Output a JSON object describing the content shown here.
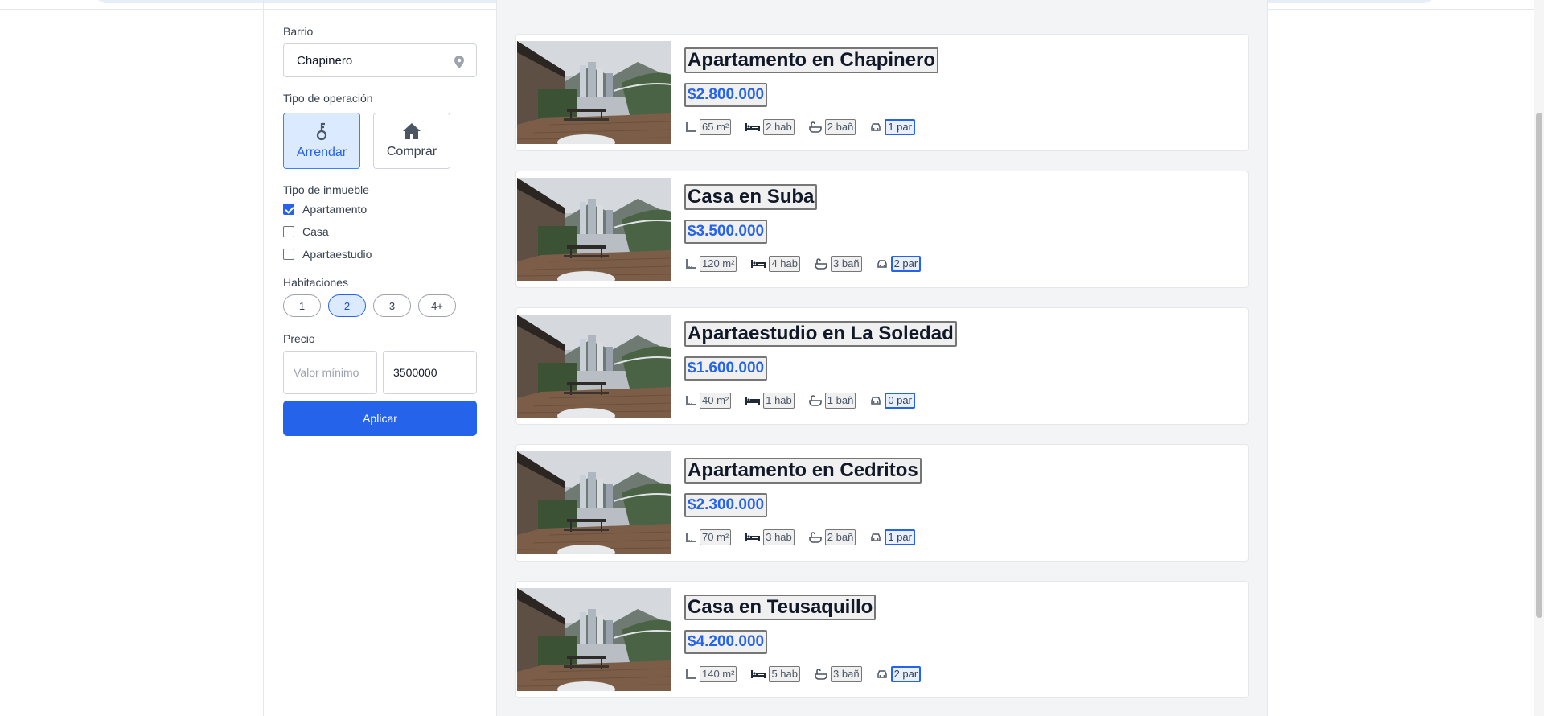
{
  "filters": {
    "barrio_label": "Barrio",
    "barrio_value": "Chapinero",
    "operation_label": "Tipo de operación",
    "operations": [
      {
        "label": "Arrendar",
        "icon": "key-icon",
        "active": true
      },
      {
        "label": "Comprar",
        "icon": "house-icon",
        "active": false
      }
    ],
    "property_type_label": "Tipo de inmueble",
    "property_types": [
      {
        "label": "Apartamento",
        "checked": true
      },
      {
        "label": "Casa",
        "checked": false
      },
      {
        "label": "Apartaestudio",
        "checked": false
      }
    ],
    "rooms_label": "Habitaciones",
    "rooms": [
      {
        "label": "1",
        "active": false
      },
      {
        "label": "2",
        "active": true
      },
      {
        "label": "3",
        "active": false
      },
      {
        "label": "4+",
        "active": false
      }
    ],
    "price_label": "Precio",
    "price_min_placeholder": "Valor mínimo",
    "price_max_value": "3500000",
    "apply_label": "Aplicar"
  },
  "listings": [
    {
      "title": "Apartamento en Chapinero",
      "price": "$2.800.000",
      "area": "65 m²",
      "beds": "2 hab",
      "baths": "2 bañ",
      "parking": "1 par"
    },
    {
      "title": "Casa en Suba",
      "price": "$3.500.000",
      "area": "120 m²",
      "beds": "4 hab",
      "baths": "3 bañ",
      "parking": "2 par"
    },
    {
      "title": "Apartaestudio en La Soledad",
      "price": "$1.600.000",
      "area": "40 m²",
      "beds": "1 hab",
      "baths": "1 bañ",
      "parking": "0 par"
    },
    {
      "title": "Apartamento en Cedritos",
      "price": "$2.300.000",
      "area": "70 m²",
      "beds": "3 hab",
      "baths": "2 bañ",
      "parking": "1 par"
    },
    {
      "title": "Casa en Teusaquillo",
      "price": "$4.200.000",
      "area": "140 m²",
      "beds": "5 hab",
      "baths": "3 bañ",
      "parking": "2 par"
    }
  ],
  "colors": {
    "accent": "#2563eb",
    "active_bg": "#dbeafe",
    "main_bg": "#f3f4f6"
  }
}
